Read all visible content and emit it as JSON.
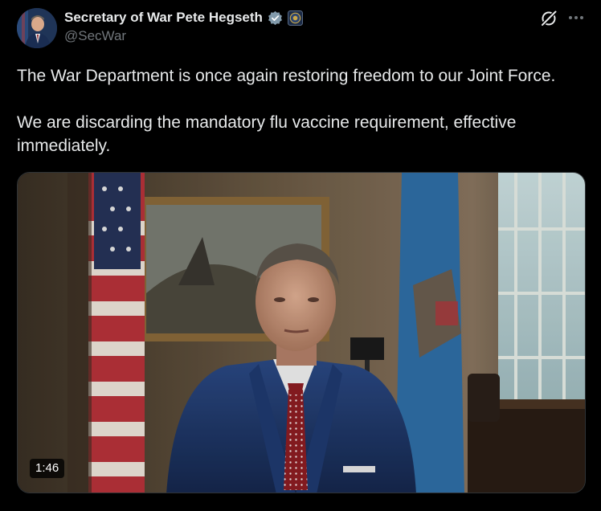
{
  "author": {
    "display_name": "Secretary of War Pete Hegseth",
    "handle": "@SecWar",
    "verified_badge_color": "#829aab",
    "avatar_icon": "profile-photo"
  },
  "actions": {
    "grok_icon": "grok-icon",
    "more_icon": "more-options-icon"
  },
  "post": {
    "paragraphs": [
      "The War Department is once again restoring freedom to our Joint Force.",
      "We are discarding the mandatory flu vaccine requirement, effective immediately."
    ]
  },
  "media": {
    "type": "video",
    "duration": "1:46"
  },
  "colors": {
    "background": "#000000",
    "text_primary": "#e7e9ea",
    "text_secondary": "#71767b",
    "border": "#2f3336"
  }
}
